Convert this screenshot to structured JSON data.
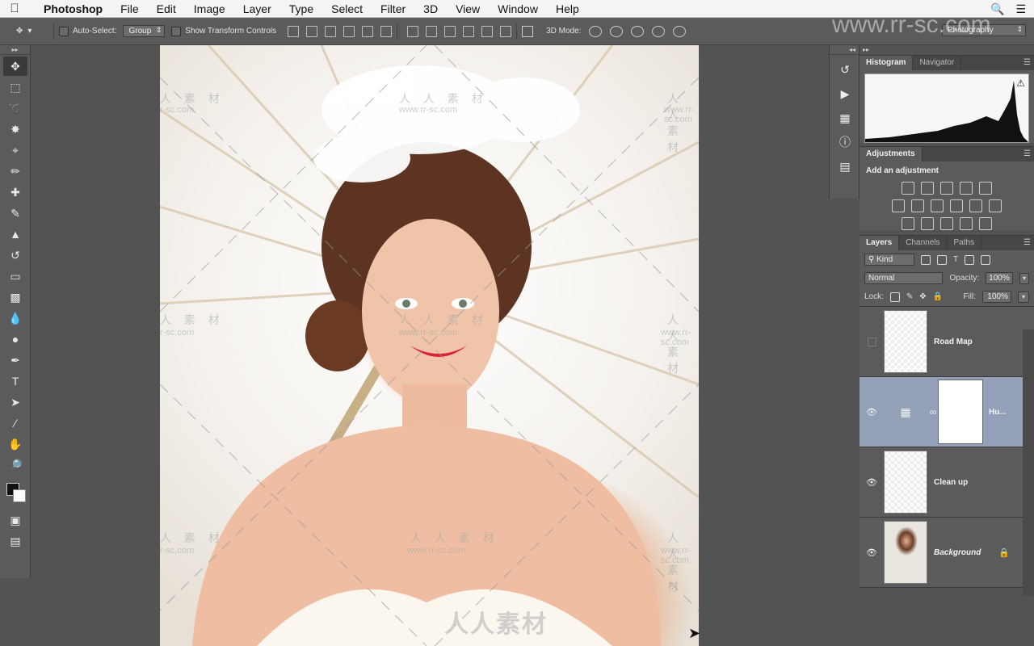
{
  "menubar": {
    "apple": "",
    "items": [
      "Photoshop",
      "File",
      "Edit",
      "Image",
      "Layer",
      "Type",
      "Select",
      "Filter",
      "3D",
      "View",
      "Window",
      "Help"
    ],
    "search_icon": "search-icon",
    "list_icon": "list-icon"
  },
  "options": {
    "auto_select_label": "Auto-Select:",
    "auto_select_value": "Group",
    "show_transform_label": "Show Transform Controls",
    "mode_3d_label": "3D Mode:",
    "workspace_value": "Photography"
  },
  "watermark": {
    "site": "www.rr-sc.com",
    "cn": "人人素材",
    "cn_spaced": "人 人 素 材",
    "url": "www.rr-sc.com"
  },
  "panels": {
    "histogram_tab": "Histogram",
    "navigator_tab": "Navigator",
    "adjustments_tab": "Adjustments",
    "add_adjustment": "Add an adjustment",
    "layers_tab": "Layers",
    "channels_tab": "Channels",
    "paths_tab": "Paths",
    "kind_value": "Kind",
    "blend_mode": "Normal",
    "opacity_label": "Opacity:",
    "opacity_value": "100%",
    "lock_label": "Lock:",
    "fill_label": "Fill:",
    "fill_value": "100%"
  },
  "layers": [
    {
      "name": "Road Map",
      "visible": false,
      "selected": false
    },
    {
      "name": "Hu...",
      "visible": true,
      "selected": true
    },
    {
      "name": "Clean up",
      "visible": true,
      "selected": false
    },
    {
      "name": "Background",
      "visible": true,
      "selected": false,
      "locked": true
    }
  ]
}
